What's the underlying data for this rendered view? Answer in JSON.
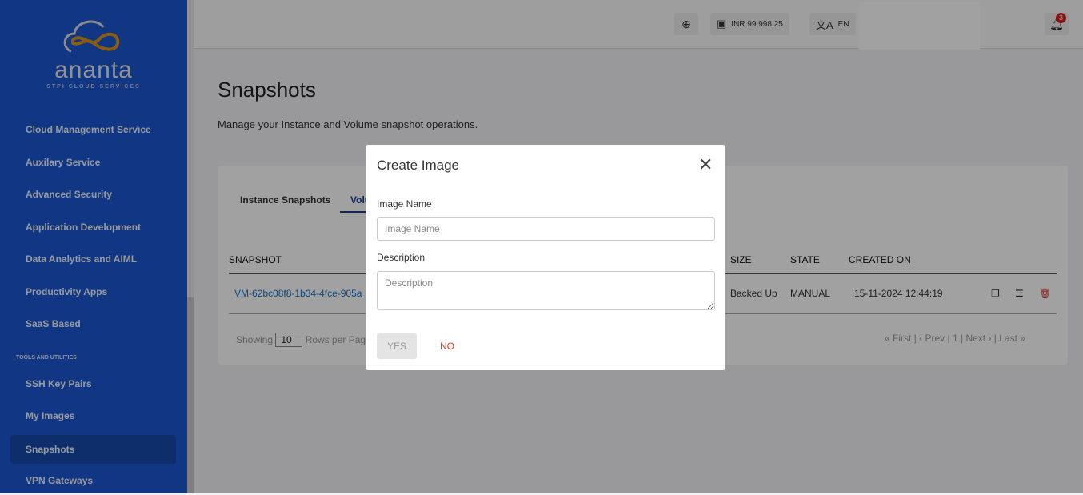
{
  "brand": {
    "name": "ananta",
    "tagline": "STPI CLOUD SERVICES"
  },
  "sidebar": {
    "items": [
      {
        "label": "Cloud Management Service"
      },
      {
        "label": "Auxilary Service"
      },
      {
        "label": "Advanced Security"
      },
      {
        "label": "Application Development"
      },
      {
        "label": "Data Analytics and AIML"
      },
      {
        "label": "Productivity Apps"
      },
      {
        "label": "SaaS Based"
      }
    ],
    "section": "TOOLS AND UTILITIES",
    "tools": [
      {
        "label": "SSH Key Pairs"
      },
      {
        "label": "My Images"
      },
      {
        "label": "Snapshots",
        "active": true
      },
      {
        "label": "VPN Gateways"
      }
    ]
  },
  "header": {
    "balance": "INR 99,998.25",
    "language": "EN",
    "notifications": "3"
  },
  "page": {
    "title": "Snapshots",
    "subtitle": "Manage your Instance and Volume snapshot operations."
  },
  "tabs": [
    {
      "label": "Instance Snapshots"
    },
    {
      "label": "Volume Snapshots",
      "active": true
    }
  ],
  "table": {
    "columns": [
      "SNAPSHOT",
      "SIZE",
      "STATE",
      "CREATED ON"
    ],
    "rows": [
      {
        "snapshot": "VM-62bc08f8-1b34-4fce-905a",
        "size": "Backed Up",
        "state": "MANUAL",
        "created": "15-11-2024 12:44:19"
      }
    ]
  },
  "pagination": {
    "showing": "Showing",
    "rows": "10",
    "rows_label": "Rows per Page",
    "first": "« First",
    "prev": "‹ Prev",
    "page": "1",
    "next": "Next ›",
    "last": "Last »"
  },
  "modal": {
    "title": "Create Image",
    "name_label": "Image Name",
    "name_placeholder": "Image Name",
    "desc_label": "Description",
    "desc_placeholder": "Description",
    "yes": "YES",
    "no": "NO"
  }
}
